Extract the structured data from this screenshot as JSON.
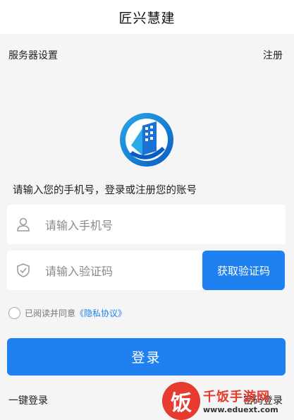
{
  "header": {
    "title": "匠兴慧建"
  },
  "topbar": {
    "server_settings": "服务器设置",
    "register": "注册"
  },
  "login": {
    "prompt": "请输入您的手机号，登录或注册您的账号",
    "phone_placeholder": "请输入手机号",
    "code_placeholder": "请输入验证码",
    "get_code_label": "获取验证码",
    "agree_text": "已阅读并同意",
    "privacy_link": "《隐私协议》",
    "login_label": "登录",
    "one_click_login": "一键登录",
    "right_link": "密码登录"
  },
  "watermark": {
    "logo_char": "饭",
    "name": "千饭手游网",
    "url": "www.eduext.com"
  },
  "colors": {
    "accent": "#1f80f0",
    "watermark": "#e63b2e",
    "background": "#f5f5f5"
  },
  "icons": {
    "phone_field": "user-icon",
    "code_field": "shield-check-icon"
  }
}
